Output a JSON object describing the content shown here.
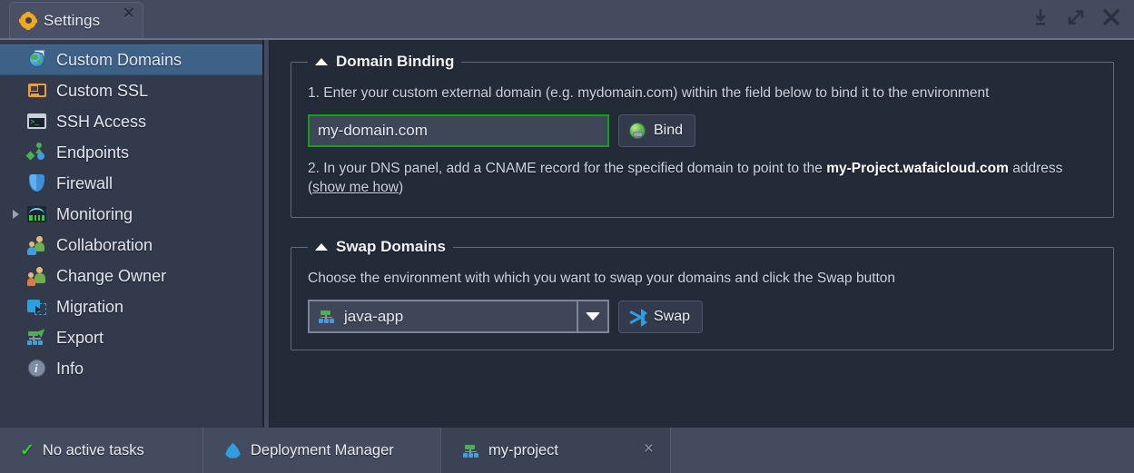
{
  "window": {
    "tab_title": "Settings",
    "tab_icon": "gear-icon",
    "close_label": "✕",
    "controls": [
      {
        "name": "minimize-to-tray-icon",
        "label": "download"
      },
      {
        "name": "maximize-icon",
        "label": "expand"
      },
      {
        "name": "close-window-icon",
        "label": "close"
      }
    ]
  },
  "sidebar": {
    "items": [
      {
        "label": "Custom Domains",
        "icon": "globe-document-icon",
        "selected": true,
        "expandable": false
      },
      {
        "label": "Custom SSL",
        "icon": "certificate-card-icon",
        "selected": false,
        "expandable": false
      },
      {
        "label": "SSH Access",
        "icon": "terminal-icon",
        "selected": false,
        "expandable": false
      },
      {
        "label": "Endpoints",
        "icon": "endpoints-icon",
        "selected": false,
        "expandable": false
      },
      {
        "label": "Firewall",
        "icon": "shield-icon",
        "selected": false,
        "expandable": false
      },
      {
        "label": "Monitoring",
        "icon": "chart-icon",
        "selected": false,
        "expandable": true
      },
      {
        "label": "Collaboration",
        "icon": "people-icon",
        "selected": false,
        "expandable": false
      },
      {
        "label": "Change Owner",
        "icon": "people-swap-icon",
        "selected": false,
        "expandable": false
      },
      {
        "label": "Migration",
        "icon": "migration-icon",
        "selected": false,
        "expandable": false
      },
      {
        "label": "Export",
        "icon": "export-icon",
        "selected": false,
        "expandable": false
      },
      {
        "label": "Info",
        "icon": "info-icon",
        "selected": false,
        "expandable": false
      }
    ]
  },
  "content": {
    "domain_binding": {
      "legend": "Domain Binding",
      "step1_text": "1. Enter your custom external domain (e.g. mydomain.com) within the field below to bind it to the environment",
      "domain_input_value": "my-domain.com",
      "domain_input_placeholder": "",
      "bind_button": "Bind",
      "bind_icon": "globe-bind-icon",
      "step2_prefix": "2. In your DNS panel, add a CNAME record for the specified domain to point to the ",
      "step2_bold": "my-Project.wafaicloud.com",
      "step2_mid": " address (",
      "step2_link": "show me how",
      "step2_suffix": ")",
      "input_border_color": "#14a014"
    },
    "swap_domains": {
      "legend": "Swap Domains",
      "description": "Choose the environment with which you want to swap your domains and click the Swap button",
      "selected_environment": "java-app",
      "select_icon": "environment-nodes-icon",
      "swap_button": "Swap",
      "swap_icon": "swap-arrows-icon"
    }
  },
  "statusbar": {
    "tasks_label": "No active tasks",
    "tasks_icon": "check-icon",
    "deployment_manager_label": "Deployment Manager",
    "deployment_manager_icon": "cloud-icon",
    "project_tab_label": "my-project",
    "project_tab_icon": "environment-nodes-icon",
    "project_tab_close": "×"
  }
}
